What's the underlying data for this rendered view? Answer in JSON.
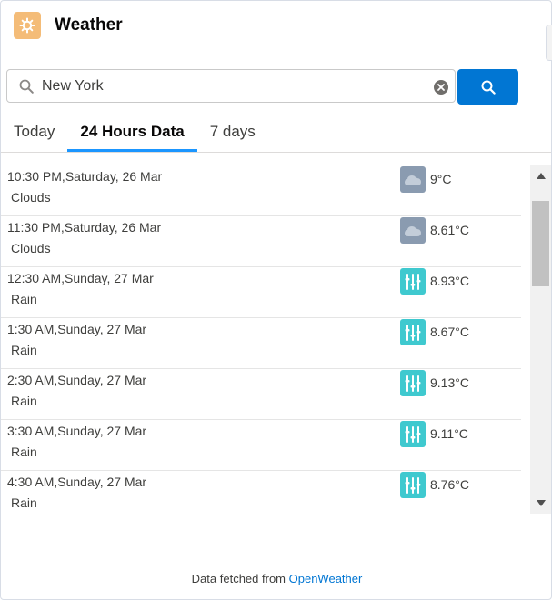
{
  "app": {
    "title": "Weather",
    "icon": "sun-gear-icon",
    "icon_color": "#f4bc78"
  },
  "search": {
    "value": "New York",
    "button_color": "#0176d3"
  },
  "tabs": [
    {
      "label": "Today",
      "active": false
    },
    {
      "label": "24 Hours Data",
      "active": true
    },
    {
      "label": "7 days",
      "active": false
    }
  ],
  "forecast": [
    {
      "time": "10:30 PM,Saturday, 26 Mar",
      "condition": "Clouds",
      "temp": "9°C",
      "icon": "clouds-icon"
    },
    {
      "time": "11:30 PM,Saturday, 26 Mar",
      "condition": "Clouds",
      "temp": "8.61°C",
      "icon": "clouds-icon"
    },
    {
      "time": "12:30 AM,Sunday, 27 Mar",
      "condition": "Rain",
      "temp": "8.93°C",
      "icon": "rain-icon"
    },
    {
      "time": "1:30 AM,Sunday, 27 Mar",
      "condition": "Rain",
      "temp": "8.67°C",
      "icon": "rain-icon"
    },
    {
      "time": "2:30 AM,Sunday, 27 Mar",
      "condition": "Rain",
      "temp": "9.13°C",
      "icon": "rain-icon"
    },
    {
      "time": "3:30 AM,Sunday, 27 Mar",
      "condition": "Rain",
      "temp": "9.11°C",
      "icon": "rain-icon"
    },
    {
      "time": "4:30 AM,Sunday, 27 Mar",
      "condition": "Rain",
      "temp": "8.76°C",
      "icon": "rain-icon"
    }
  ],
  "colors": {
    "clouds": "#8a9bb0",
    "rain": "#3fc9cf",
    "tab_underline": "#1b96ff"
  },
  "footer": {
    "prefix": "Data fetched from",
    "link": "OpenWeather"
  }
}
